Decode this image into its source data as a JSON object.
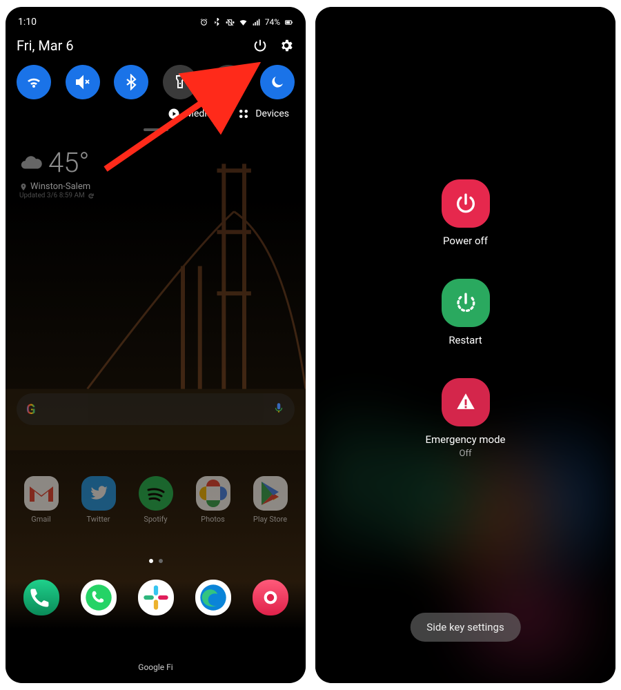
{
  "left": {
    "status": {
      "time": "1:10",
      "battery": "74%"
    },
    "date": "Fri, Mar 6",
    "qs_tiles": [
      {
        "name": "wifi",
        "on": true
      },
      {
        "name": "mute",
        "on": true
      },
      {
        "name": "bluetooth",
        "on": true
      },
      {
        "name": "flashlight",
        "on": false
      },
      {
        "name": "battery-saver",
        "on": false
      },
      {
        "name": "dnd",
        "on": true
      }
    ],
    "media_label": "Media",
    "devices_label": "Devices",
    "weather": {
      "temperature": "45°",
      "location": "Winston-Salem",
      "updated": "Updated 3/6 8:59 AM"
    },
    "apps_row": [
      {
        "label": "Gmail"
      },
      {
        "label": "Twitter"
      },
      {
        "label": "Spotify"
      },
      {
        "label": "Photos"
      },
      {
        "label": "Play Store"
      }
    ],
    "google_fi_label": "Google Fi"
  },
  "right": {
    "power_off_label": "Power off",
    "restart_label": "Restart",
    "emergency_label": "Emergency mode",
    "emergency_state": "Off",
    "side_key_label": "Side key settings"
  },
  "accent_colors": {
    "qs_blue": "#1a73e8",
    "power_red": "#e6284d",
    "restart_green": "#2aa95f"
  }
}
